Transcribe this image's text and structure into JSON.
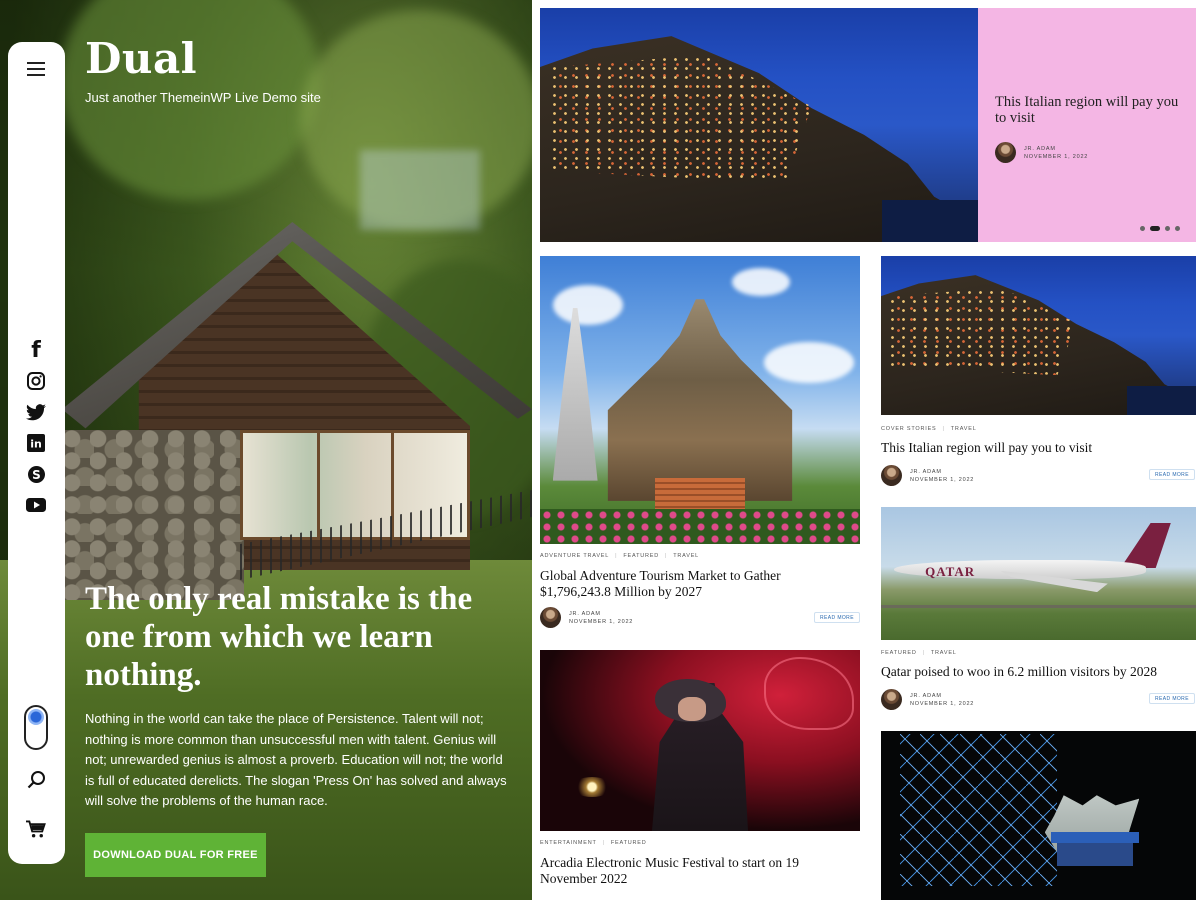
{
  "site": {
    "title": "Dual",
    "tagline": "Just another ThemeinWP Live Demo site"
  },
  "hero": {
    "heading": "The only real mistake is the one from which we learn nothing.",
    "text": "Nothing in the world can take the place of Persistence. Talent will not; nothing is more common than unsuccessful men with talent. Genius will not; unrewarded genius is almost a proverb. Education will not; the world is full of educated derelicts. The slogan 'Press On' has solved and always will solve the problems of the human race.",
    "cta_label": "DOWNLOAD DUAL FOR FREE",
    "cta_color": "#5fb336"
  },
  "sidebar": {
    "icons": [
      "menu-icon",
      "facebook-icon",
      "instagram-icon",
      "twitter-icon",
      "linkedin-icon",
      "skype-icon",
      "youtube-icon",
      "theme-toggle",
      "search-icon",
      "cart-icon"
    ],
    "social_glyphs": {
      "facebook": "f",
      "linkedin": "in",
      "skype": "S"
    }
  },
  "slider": {
    "title": "This Italian region will pay you to visit",
    "author": "JR. ADAM",
    "date": "NOVEMBER 1, 2022",
    "dots": 4,
    "active_dot": 2,
    "panel_color": "#f4b6e4"
  },
  "posts": [
    {
      "categories": [
        "ADVENTURE TRAVEL",
        "FEATURED",
        "TRAVEL"
      ],
      "title": "Global Adventure Tourism Market to Gather $1,796,243.8 Million by 2027",
      "author": "JR. ADAM",
      "date": "NOVEMBER 1, 2022",
      "read_more": "READ MORE"
    },
    {
      "categories": [
        "COVER STORIES",
        "TRAVEL"
      ],
      "title": "This Italian region will pay you to visit",
      "author": "JR. ADAM",
      "date": "NOVEMBER 1, 2022",
      "read_more": "READ MORE"
    },
    {
      "categories": [
        "FEATURED",
        "TRAVEL"
      ],
      "title": "Qatar poised to woo in 6.2 million visitors by 2028",
      "author": "JR. ADAM",
      "date": "NOVEMBER 1, 2022",
      "read_more": "READ MORE",
      "image_brand_text": "QATAR"
    },
    {
      "categories": [
        "ENTERTAINMENT",
        "FEATURED"
      ],
      "title": "Arcadia Electronic Music Festival to start on 19 November 2022"
    }
  ]
}
